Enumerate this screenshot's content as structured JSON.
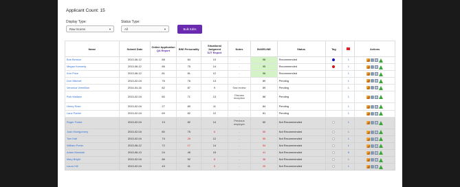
{
  "applicant_count": "Applicant Count: 15",
  "filters": {
    "display_type_label": "Display Type:",
    "display_type_value": "Raw Scores",
    "status_type_label": "Status Type:",
    "status_type_value": "All",
    "button_label": "Bulk Edits"
  },
  "table": {
    "headers": {
      "name": "Name",
      "submit_date": "Submit Date",
      "online_app": "Online Application",
      "online_app_sub": "QA Report",
      "bwi": "BWI Personality",
      "sjt": "Situational Judgment",
      "sjt_sub": "SJT Report",
      "notes": "Notes",
      "baseline": "BASELINE",
      "status": "Status",
      "tag": "Tag",
      "actions": "Actions"
    },
    "rows": [
      {
        "name": "Bob Benson",
        "date": "2013-06-12",
        "online": "88",
        "bwi": "84",
        "sjt": "13",
        "sjt_red": false,
        "notes": "-",
        "baseline": "98",
        "base_red": false,
        "status": "Recommended",
        "tag": "#1010d0",
        "flag": "1",
        "grey": false,
        "green": true
      },
      {
        "name": "Megan Kennedy",
        "date": "2013-06-12",
        "online": "86",
        "bwi": "75",
        "sjt": "14",
        "sjt_red": false,
        "notes": "-",
        "baseline": "95",
        "base_red": false,
        "status": "Recommended",
        "tag": "#e01010",
        "flag": "1",
        "grey": false,
        "green": true
      },
      {
        "name": "Ken Price",
        "date": "2013-06-12",
        "online": "81",
        "bwi": "81",
        "sjt": "12",
        "sjt_red": false,
        "notes": "-",
        "baseline": "96",
        "base_red": false,
        "status": "Recommended",
        "tag": "",
        "flag": "1",
        "grey": false,
        "green": true
      },
      {
        "name": "Don Mitchell",
        "date": "2013-02-04",
        "online": "76",
        "bwi": "76",
        "sjt": "13",
        "sjt_red": false,
        "notes": "-",
        "baseline": "89",
        "base_red": false,
        "status": "Pending",
        "tag": "",
        "flag": "1",
        "grey": false,
        "green": false
      },
      {
        "name": "Veronica Vermillion",
        "date": "2014-04-16",
        "online": "82",
        "bwi": "87",
        "sjt": "9",
        "sjt_red": false,
        "notes": "Sea review",
        "baseline": "89",
        "base_red": false,
        "status": "Pending",
        "tag": "",
        "flag": "1",
        "grey": false,
        "green": false
      },
      {
        "name": "Rob Wallace",
        "date": "2013-02-04",
        "online": "80",
        "bwi": "71",
        "sjt": "13",
        "sjt_red": false,
        "notes": "Discuss reception",
        "baseline": "88",
        "base_red": false,
        "status": "Pending",
        "tag": "",
        "flag": "1",
        "grey": false,
        "green": false,
        "tall": true
      },
      {
        "name": "Henry Rose",
        "date": "2013-02-04",
        "online": "27",
        "bwi": "89",
        "sjt": "11",
        "sjt_red": false,
        "notes": "-",
        "baseline": "84",
        "base_red": false,
        "status": "Pending",
        "tag": "",
        "flag": "1",
        "grey": false,
        "green": false
      },
      {
        "name": "Lane Parker",
        "date": "2013-02-04",
        "online": "69",
        "bwi": "82",
        "sjt": "12",
        "sjt_red": false,
        "notes": "-",
        "baseline": "81",
        "base_red": false,
        "status": "Pending",
        "tag": "",
        "flag": "1",
        "grey": false,
        "green": false
      },
      {
        "name": "Roger Foster",
        "date": "2013-02-04",
        "online": "13",
        "bwi": "82",
        "sjt": "14",
        "sjt_red": false,
        "notes": "Previous employer",
        "baseline": "60",
        "base_red": false,
        "status": "Not Recommended",
        "tag": "#ffffff",
        "flag": "1",
        "grey": true,
        "green": false,
        "tall": true
      },
      {
        "name": "Joan Montgomery",
        "date": "2013-02-04",
        "online": "80",
        "bwi": "75",
        "sjt": "6",
        "sjt_red": true,
        "notes": "-",
        "baseline": "55",
        "base_red": true,
        "status": "Not Recommended",
        "tag": "#ffffff",
        "flag": "1",
        "grey": true,
        "green": false
      },
      {
        "name": "Tom Hall",
        "date": "2013-02-04",
        "online": "74",
        "bwi": "28",
        "sjt": "12",
        "sjt_red": false,
        "notes": "-",
        "baseline": "55",
        "base_red": true,
        "status": "Not Recommended",
        "tag": "#ffffff",
        "flag": "1",
        "grey": true,
        "green": false,
        "bwi_red": true
      },
      {
        "name": "William Porter",
        "date": "2013-06-12",
        "online": "72",
        "bwi": "17",
        "sjt": "14",
        "sjt_red": false,
        "notes": "-",
        "baseline": "54",
        "base_red": true,
        "status": "Not Recommended",
        "tag": "#ffffff",
        "flag": "1",
        "grey": true,
        "green": false,
        "bwi_red": true
      },
      {
        "name": "Adam Marshall",
        "date": "2013-06-13",
        "online": "24",
        "bwi": "45",
        "sjt": "15",
        "sjt_red": false,
        "notes": "-",
        "baseline": "41",
        "base_red": true,
        "status": "Not Recommended",
        "tag": "#ffffff",
        "flag": "8",
        "grey": true,
        "green": false
      },
      {
        "name": "Mary Bright",
        "date": "2013-02-04",
        "online": "86",
        "bwi": "92",
        "sjt": "8",
        "sjt_red": true,
        "notes": "-",
        "baseline": "38",
        "base_red": true,
        "status": "Not Recommended",
        "tag": "#ffffff",
        "flag": "1",
        "grey": true,
        "green": false
      },
      {
        "name": "Laura Hill",
        "date": "2013-02-04",
        "online": "43",
        "bwi": "41",
        "sjt": "9",
        "sjt_red": true,
        "notes": "-",
        "baseline": "29",
        "base_red": true,
        "status": "Not Recommended",
        "tag": "#ffffff",
        "flag": "1",
        "grey": true,
        "green": false
      }
    ]
  }
}
